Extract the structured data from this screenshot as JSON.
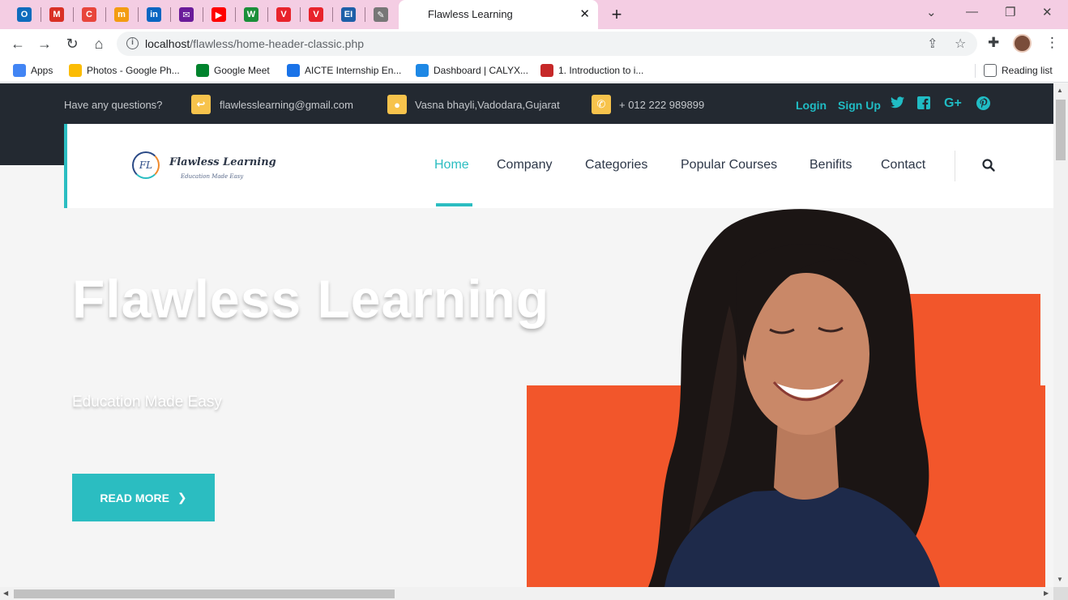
{
  "browser": {
    "pinned_tabs": [
      {
        "name": "outlook-tab",
        "icon": "outlook-icon",
        "glyph": "O",
        "color": "#0f6cbd"
      },
      {
        "name": "gmail-tab",
        "icon": "gmail-icon",
        "glyph": "M",
        "color": "#d93025"
      },
      {
        "name": "canva-tab",
        "icon": "c-logo-icon",
        "glyph": "C",
        "color": "#e8453c"
      },
      {
        "name": "m-tab",
        "icon": "m-logo-icon",
        "glyph": "m",
        "color": "#f39c12"
      },
      {
        "name": "linkedin-tab",
        "icon": "linkedin-icon",
        "glyph": "in",
        "color": "#0a66c2"
      },
      {
        "name": "mail-tab",
        "icon": "envelope-icon",
        "glyph": "✉",
        "color": "#6a1b9a"
      },
      {
        "name": "youtube-tab",
        "icon": "youtube-icon",
        "glyph": "▶",
        "color": "#ff0000"
      },
      {
        "name": "w-tab",
        "icon": "w-logo-icon",
        "glyph": "W",
        "color": "#1b8f3a"
      },
      {
        "name": "v-tab-1",
        "icon": "v-logo-icon",
        "glyph": "V",
        "color": "#e8232b"
      },
      {
        "name": "v-tab-2",
        "icon": "v-logo-icon",
        "glyph": "V",
        "color": "#e8232b"
      },
      {
        "name": "ei-tab",
        "icon": "ei-logo-icon",
        "glyph": "EI",
        "color": "#1e5fa8"
      },
      {
        "name": "feather-tab",
        "icon": "feather-icon",
        "glyph": "✎",
        "color": "#777777"
      }
    ],
    "active_tab_title": "Flawless Learning",
    "url_host": "localhost",
    "url_path": "/flawless/home-header-classic.php",
    "bookmarks": [
      {
        "label": "Apps",
        "icon": "apps-grid-icon",
        "color": "#4285f4"
      },
      {
        "label": "Photos - Google Ph...",
        "icon": "google-photos-icon",
        "color": "#fbbc04"
      },
      {
        "label": "Google Meet",
        "icon": "google-meet-icon",
        "color": "#00832d"
      },
      {
        "label": "AICTE Internship En...",
        "icon": "aicte-icon",
        "color": "#1a73e8"
      },
      {
        "label": "Dashboard | CALYX...",
        "icon": "calyx-icon",
        "color": "#1e88e5"
      },
      {
        "label": "1. Introduction to i...",
        "icon": "course-icon",
        "color": "#c62828"
      }
    ],
    "reading_list": "Reading list"
  },
  "site": {
    "topbar": {
      "question": "Have any questions?",
      "email": "flawlesslearning@gmail.com",
      "address": "Vasna bhayli,Vadodara,Gujarat",
      "phone": "+ 012 222 989899",
      "login": "Login",
      "signup": "Sign Up"
    },
    "logo": {
      "mark": "FL",
      "name": "Flawless Learning",
      "tagline": "Education Made Easy"
    },
    "menu": [
      "Home",
      "Company",
      "Categories",
      "Popular Courses",
      "Benifits",
      "Contact"
    ],
    "hero": {
      "title": "Flawless Learning",
      "subtitle": "Education Made Easy",
      "cta": "READ MORE"
    }
  },
  "colors": {
    "accent": "#2bbdc1",
    "topbar": "#232931",
    "orange": "#f2562b",
    "badge": "#f7c34c"
  }
}
